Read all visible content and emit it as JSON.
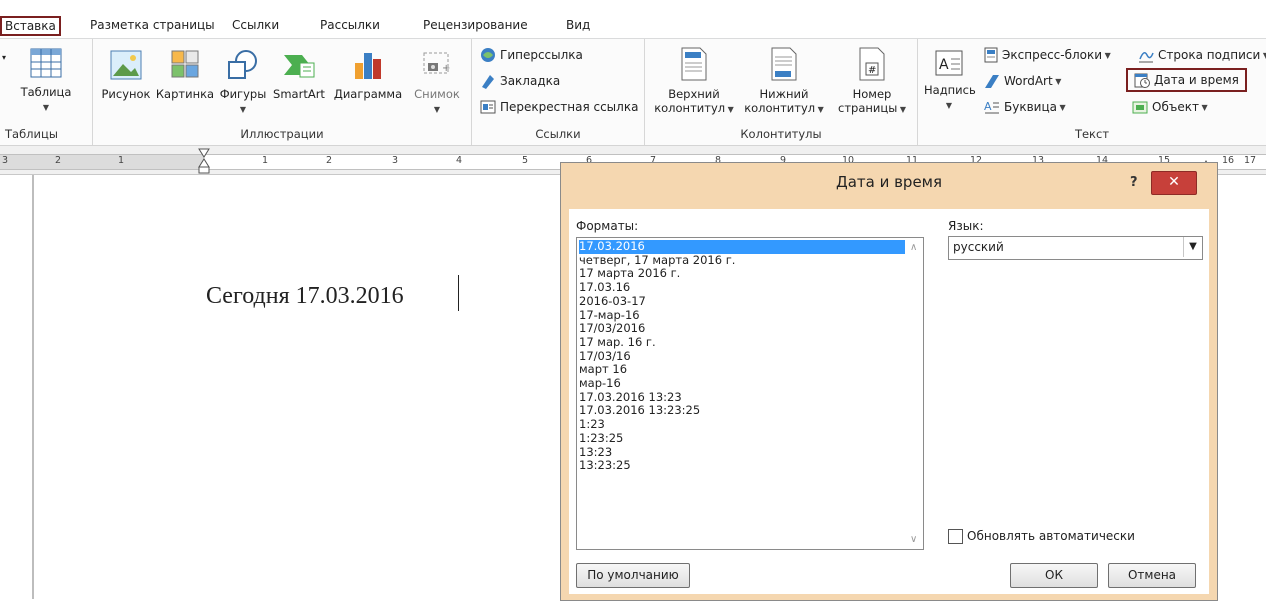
{
  "tabs": [
    "Вставка",
    "Разметка страницы",
    "Ссылки",
    "Рассылки",
    "Рецензирование",
    "Вид"
  ],
  "ribbon": {
    "tables": {
      "group_label": "Таблицы",
      "table_button": "Таблица"
    },
    "illustrations": {
      "group_label": "Иллюстрации",
      "picture": "Рисунок",
      "clipart": "Картинка",
      "shapes": "Фигуры",
      "smartart": "SmartArt",
      "chart": "Диаграмма",
      "screenshot": "Снимок"
    },
    "links": {
      "group_label": "Ссылки",
      "hyperlink": "Гиперссылка",
      "bookmark": "Закладка",
      "crossref": "Перекрестная ссылка"
    },
    "header_footer": {
      "group_label": "Колонтитулы",
      "header_line1": "Верхний",
      "header_line2": "колонтитул",
      "footer_line1": "Нижний",
      "footer_line2": "колонтитул",
      "pagenum_line1": "Номер",
      "pagenum_line2": "страницы"
    },
    "text": {
      "group_label": "Текст",
      "textbox": "Надпись",
      "quickparts": "Экспресс-блоки",
      "wordart": "WordArt",
      "dropcap": "Буквица",
      "signature": "Строка подписи",
      "datetime": "Дата и время",
      "object": "Объект"
    }
  },
  "ruler": {
    "numbers": [
      "3",
      "2",
      "1",
      "1",
      "2",
      "3",
      "4",
      "5",
      "6",
      "7",
      "8",
      "9",
      "10",
      "11",
      "12",
      "13",
      "14",
      "15",
      "16",
      "17"
    ]
  },
  "document": {
    "text": "Сегодня 17.03.2016"
  },
  "dialog": {
    "title": "Дата и время",
    "help": "?",
    "close": "✕",
    "formats_label": "Форматы:",
    "formats": [
      "17.03.2016",
      "четверг, 17 марта 2016 г.",
      "17 марта 2016 г.",
      "17.03.16",
      "2016-03-17",
      "17-мар-16",
      "17/03/2016",
      "17 мар. 16 г.",
      "17/03/16",
      "март 16",
      "мар-16",
      "17.03.2016 13:23",
      "17.03.2016 13:23:25",
      "1:23",
      "1:23:25",
      "13:23",
      "13:23:25"
    ],
    "selected_index": 0,
    "language_label": "Язык:",
    "language_value": "русский",
    "auto_update_label": "Обновлять автоматически",
    "auto_update_checked": false,
    "default_button": "По умолчанию",
    "ok_button": "ОК",
    "cancel_button": "Отмена"
  },
  "colors": {
    "highlight_border": "#7a1f1f",
    "dialog_frame": "#f5d7b0",
    "close_button": "#c7403a",
    "selection": "#3399ff"
  }
}
